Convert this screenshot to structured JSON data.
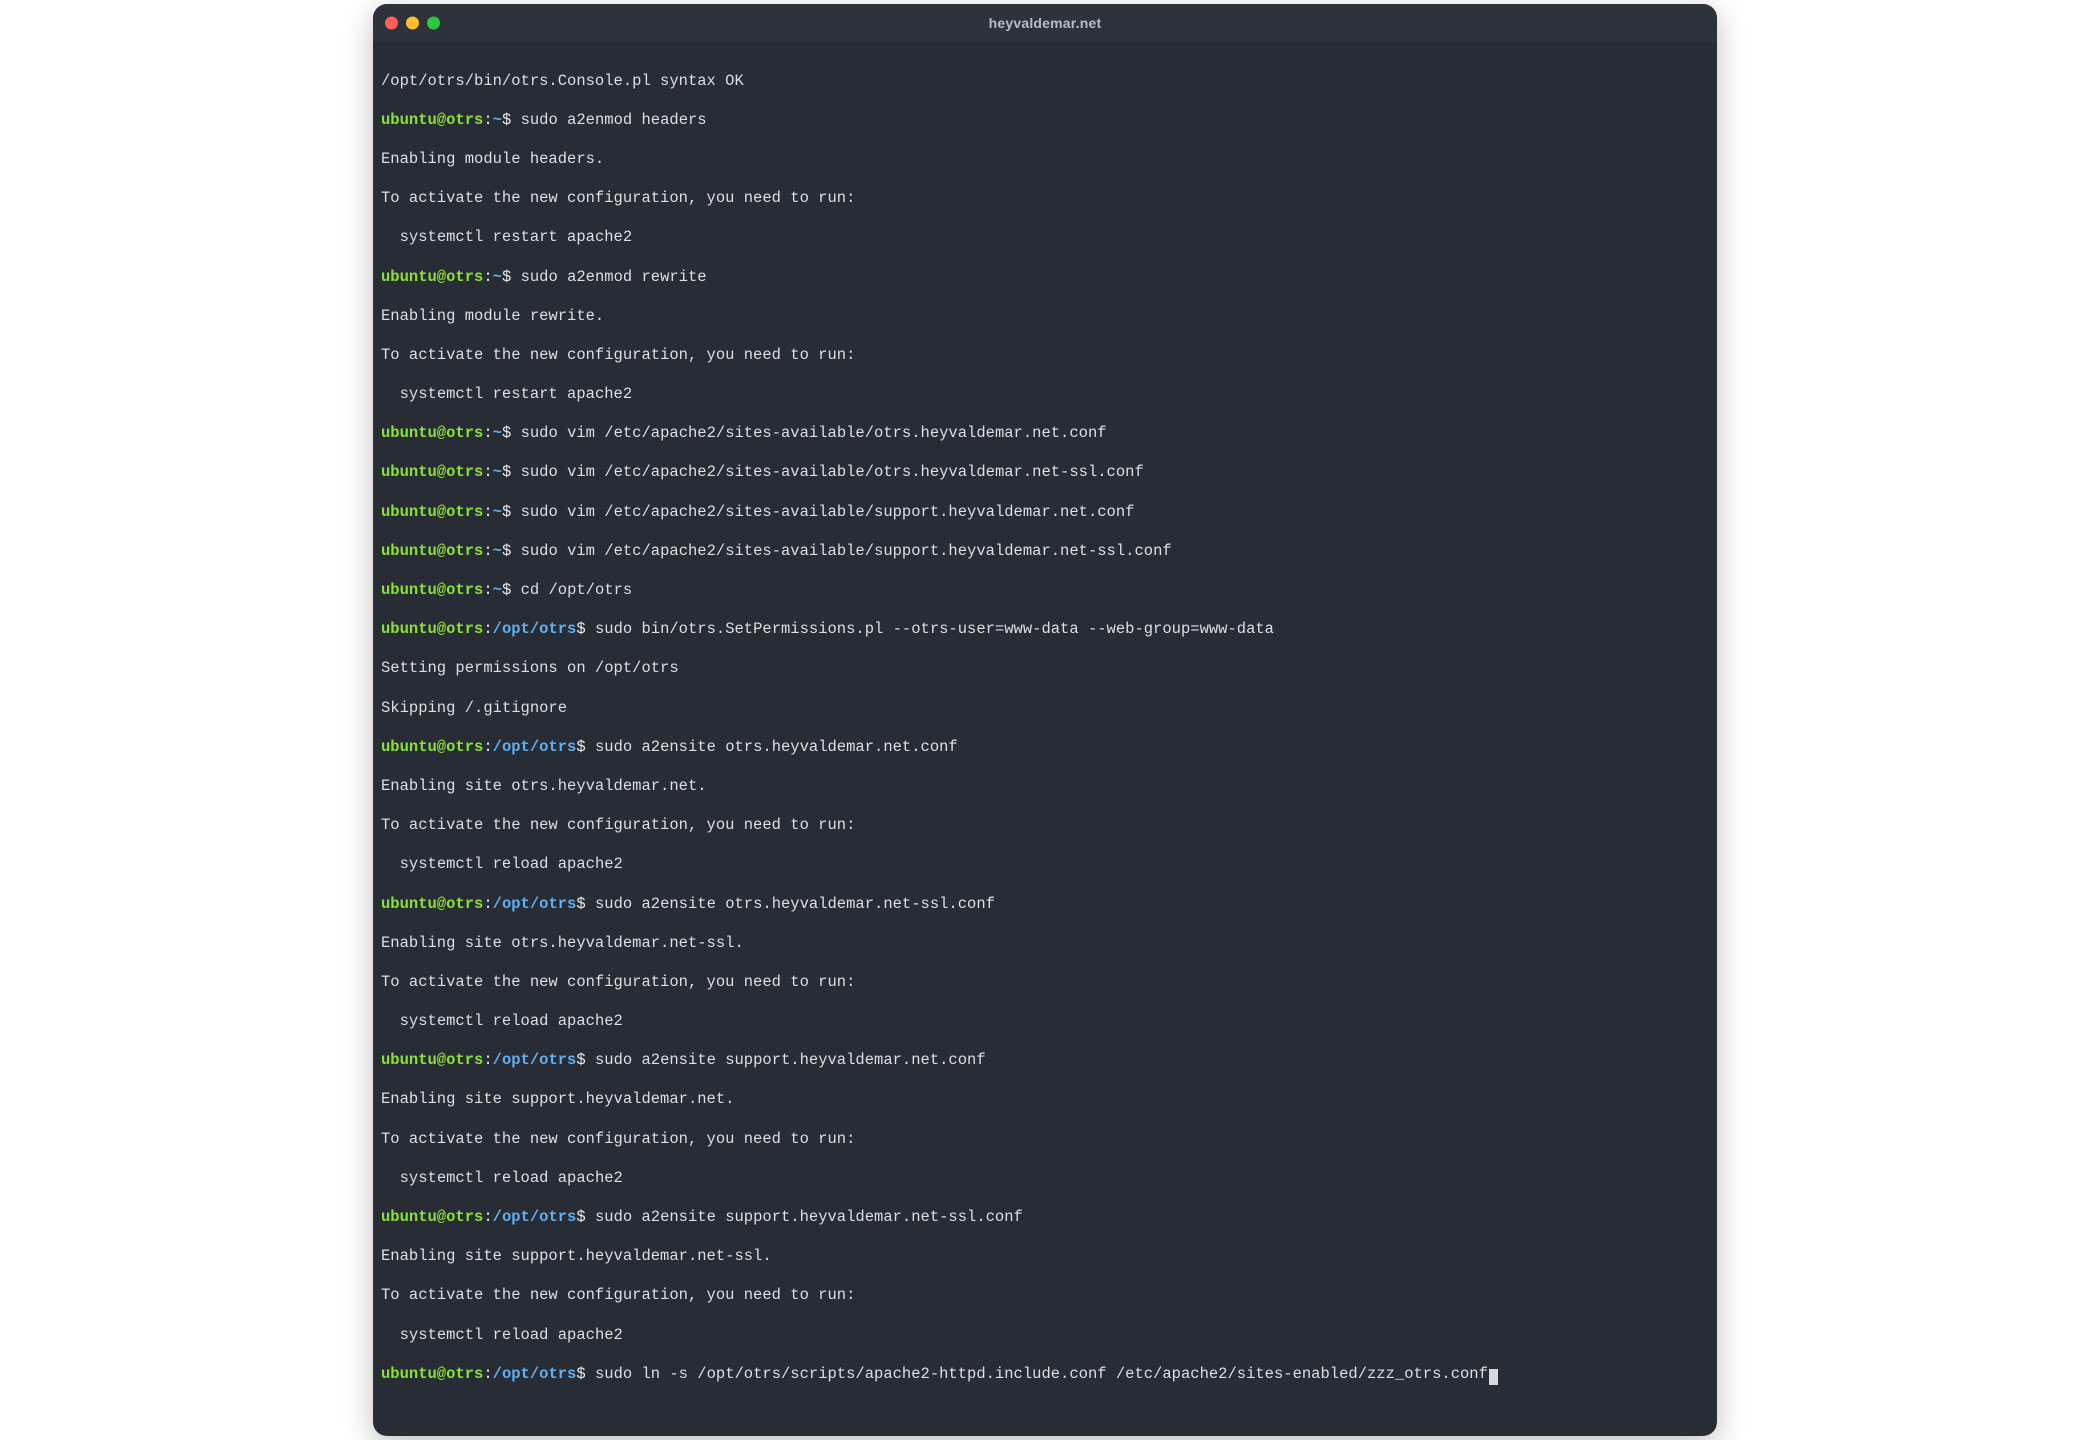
{
  "window": {
    "title": "heyvaldemar.net"
  },
  "prompt": {
    "userhost": "ubuntu@otrs",
    "home_tilde": "~",
    "cwd": "/opt/otrs",
    "sep_colon": ":",
    "sep_dollar": "$ "
  },
  "lines": {
    "l00": "/opt/otrs/bin/otrs.Console.pl syntax OK",
    "l01_cmd": "sudo a2enmod headers",
    "l02": "Enabling module headers.",
    "l03": "To activate the new configuration, you need to run:",
    "l04": "  systemctl restart apache2",
    "l05_cmd": "sudo a2enmod rewrite",
    "l06": "Enabling module rewrite.",
    "l07": "To activate the new configuration, you need to run:",
    "l08": "  systemctl restart apache2",
    "l09_cmd": "sudo vim /etc/apache2/sites-available/otrs.heyvaldemar.net.conf",
    "l10_cmd": "sudo vim /etc/apache2/sites-available/otrs.heyvaldemar.net-ssl.conf",
    "l11_cmd": "sudo vim /etc/apache2/sites-available/support.heyvaldemar.net.conf",
    "l12_cmd": "sudo vim /etc/apache2/sites-available/support.heyvaldemar.net-ssl.conf",
    "l13_cmd": "cd /opt/otrs",
    "l14_cmd": "sudo bin/otrs.SetPermissions.pl --otrs-user=www-data --web-group=www-data",
    "l15": "Setting permissions on /opt/otrs",
    "l16": "Skipping /.gitignore",
    "l17_cmd": "sudo a2ensite otrs.heyvaldemar.net.conf",
    "l18": "Enabling site otrs.heyvaldemar.net.",
    "l19": "To activate the new configuration, you need to run:",
    "l20": "  systemctl reload apache2",
    "l21_cmd": "sudo a2ensite otrs.heyvaldemar.net-ssl.conf",
    "l22": "Enabling site otrs.heyvaldemar.net-ssl.",
    "l23": "To activate the new configuration, you need to run:",
    "l24": "  systemctl reload apache2",
    "l25_cmd": "sudo a2ensite support.heyvaldemar.net.conf",
    "l26": "Enabling site support.heyvaldemar.net.",
    "l27": "To activate the new configuration, you need to run:",
    "l28": "  systemctl reload apache2",
    "l29_cmd": "sudo a2ensite support.heyvaldemar.net-ssl.conf",
    "l30": "Enabling site support.heyvaldemar.net-ssl.",
    "l31": "To activate the new configuration, you need to run:",
    "l32": "  systemctl reload apache2",
    "l33_cmd": "sudo ln -s /opt/otrs/scripts/apache2-httpd.include.conf /etc/apache2/sites-enabled/zzz_otrs.conf"
  }
}
